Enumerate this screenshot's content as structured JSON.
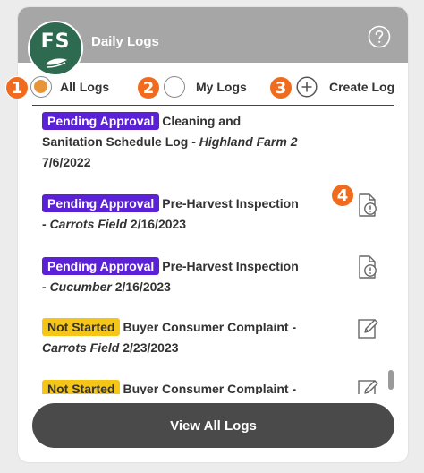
{
  "header": {
    "logo_text": "FS",
    "title": "Daily Logs",
    "help_icon": "question-circle-icon",
    "background": "#a6a6a6"
  },
  "filters": {
    "all_logs": "All Logs",
    "my_logs": "My Logs",
    "create_log": "Create Log",
    "selected": "All Logs"
  },
  "callouts": [
    "1",
    "2",
    "3",
    "4"
  ],
  "colors": {
    "accent_orange": "#e8953a",
    "callout": "#f06b1e",
    "pending": "#5b21d6",
    "not_started": "#f5c518",
    "logo_green": "#2d6a4f",
    "button": "#4a4a4a"
  },
  "items": [
    {
      "status": "Pending Approval",
      "line1": "Cleaning and",
      "line2a": "Sanitation Schedule Log - ",
      "location": "Highland Farm 2",
      "date": "7/6/2022",
      "icon": "none"
    },
    {
      "status": "Pending Approval",
      "line1": "Pre-Harvest Inspection",
      "line2a": "- ",
      "location": "Carrots Field",
      "date": "2/16/2023",
      "icon": "document-alert-icon"
    },
    {
      "status": "Pending Approval",
      "line1": "Pre-Harvest Inspection",
      "line2a": "- ",
      "location": "Cucumber",
      "date": "2/16/2023",
      "icon": "document-alert-icon"
    },
    {
      "status": "Not Started",
      "line1": "Buyer Consumer Complaint -",
      "line2a": "",
      "location": "Carrots Field",
      "date": "2/23/2023",
      "icon": "edit-icon"
    },
    {
      "status": "Not Started",
      "line1": "Buyer Consumer Complaint -",
      "line2a": "",
      "location": "",
      "date": "",
      "icon": "edit-icon"
    }
  ],
  "footer": {
    "view_all": "View All Logs"
  }
}
